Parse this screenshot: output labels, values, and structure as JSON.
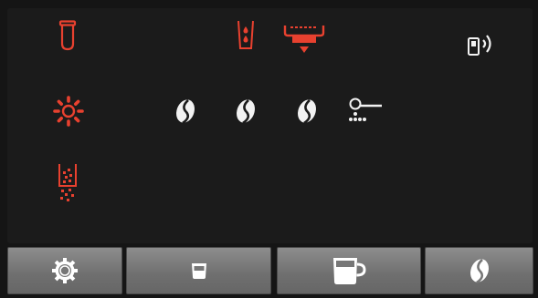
{
  "colors": {
    "background": "#1b1b1b",
    "alert": "#e8412f",
    "icon": "#f2f2f2",
    "button": "#7a7a7a",
    "button_icon": "#ffffff"
  },
  "status_icons": {
    "row1": [
      "filter-cartridge-icon",
      "water-tank-icon",
      "drip-tray-icon",
      "bluetooth-connection-icon"
    ],
    "row2": [
      "rinse-sun-icon",
      "bean-strength-icon",
      "bean-strength-icon",
      "bean-strength-icon",
      "grinder-ground-coffee-icon"
    ],
    "row3": [
      "grounds-container-icon"
    ]
  },
  "bean_strength_level": 3,
  "bottom_bar": [
    {
      "icon": "gear-icon"
    },
    {
      "icon": "small-cup-icon"
    },
    {
      "icon": "mug-icon"
    },
    {
      "icon": "coffee-bean-icon"
    }
  ]
}
